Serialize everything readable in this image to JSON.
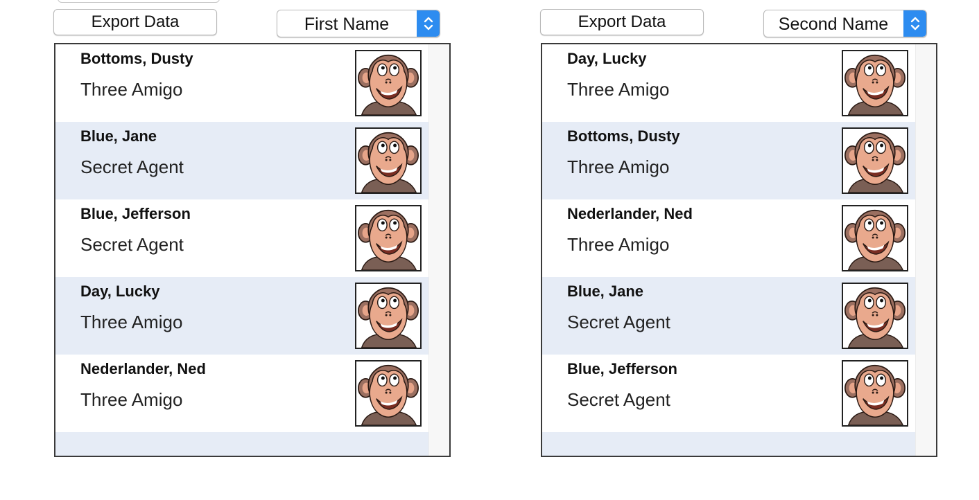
{
  "left_panel": {
    "export_label": "Export Data",
    "sort_selected": "First Name",
    "rows": [
      {
        "name": "Bottoms, Dusty",
        "role": "Three Amigo"
      },
      {
        "name": "Blue, Jane",
        "role": "Secret Agent"
      },
      {
        "name": "Blue, Jefferson",
        "role": "Secret Agent"
      },
      {
        "name": "Day, Lucky",
        "role": "Three Amigo"
      },
      {
        "name": "Nederlander, Ned",
        "role": "Three Amigo"
      }
    ]
  },
  "right_panel": {
    "export_label": "Export Data",
    "sort_selected": "Second Name",
    "rows": [
      {
        "name": "Day, Lucky",
        "role": "Three Amigo"
      },
      {
        "name": "Bottoms, Dusty",
        "role": "Three Amigo"
      },
      {
        "name": "Nederlander, Ned",
        "role": "Three Amigo"
      },
      {
        "name": "Blue, Jane",
        "role": "Secret Agent"
      },
      {
        "name": "Blue, Jefferson",
        "role": "Secret Agent"
      }
    ]
  },
  "colors": {
    "accent": "#2d8cf0",
    "row_alt": "#e6ecf6",
    "border": "#3a3a3a"
  },
  "icons": {
    "avatar": "monkey-avatar-icon",
    "stepper": "up-down-chevron-icon"
  }
}
